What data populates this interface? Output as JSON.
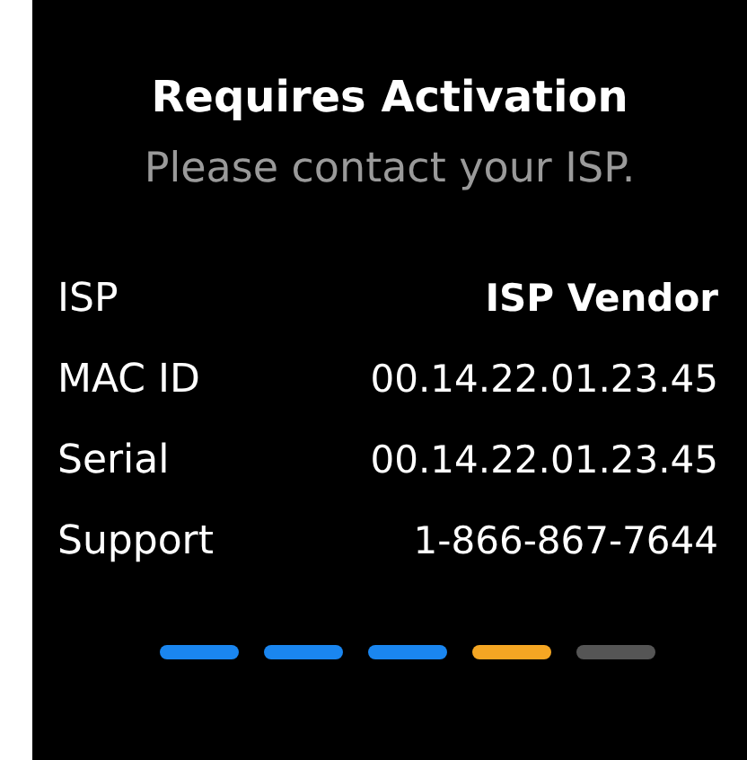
{
  "title": "Requires Activation",
  "subtitle": "Please contact your ISP.",
  "details": [
    {
      "label": "ISP",
      "value": "ISP Vendor",
      "bold": true
    },
    {
      "label": "MAC ID",
      "value": "00.14.22.01.23.45",
      "bold": false
    },
    {
      "label": "Serial",
      "value": "00.14.22.01.23.45",
      "bold": false
    },
    {
      "label": "Support",
      "value": "1-866-867-7644",
      "bold": false
    }
  ],
  "steps": [
    {
      "color": "#1a86f0"
    },
    {
      "color": "#1a86f0"
    },
    {
      "color": "#1a86f0"
    },
    {
      "color": "#f5a623"
    },
    {
      "color": "#555555"
    }
  ]
}
